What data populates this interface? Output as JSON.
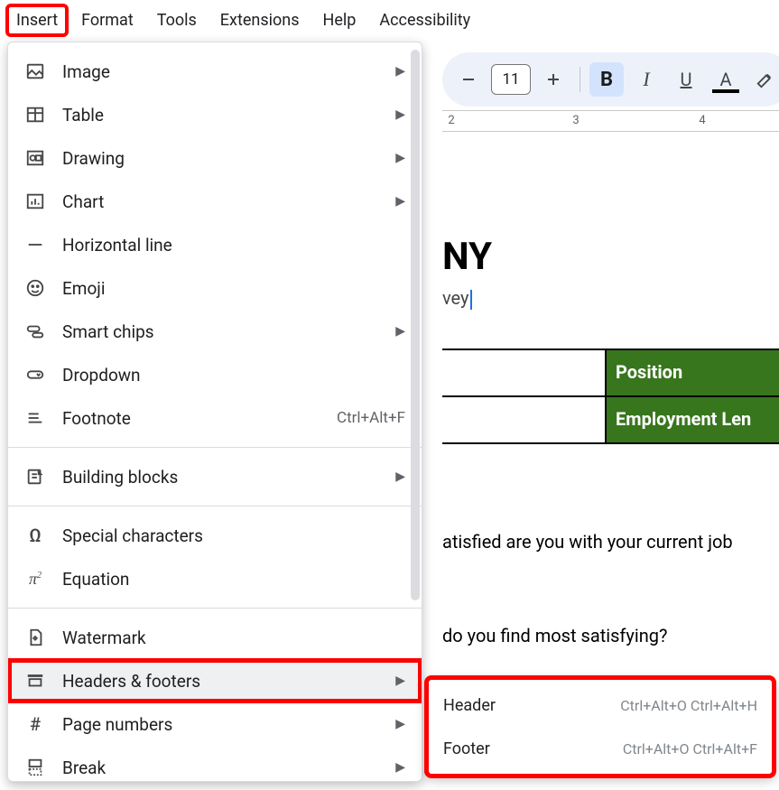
{
  "menubar": {
    "insert": "Insert",
    "format": "Format",
    "tools": "Tools",
    "extensions": "Extensions",
    "help": "Help",
    "accessibility": "Accessibility"
  },
  "toolbar": {
    "font_size": "11",
    "bold_glyph": "B",
    "italic_glyph": "I",
    "underline_glyph": "U",
    "textcolor_glyph": "A"
  },
  "ruler": {
    "n2": "2",
    "n3": "3",
    "n4": "4"
  },
  "doc": {
    "heading_fragment": "NY",
    "subtitle_fragment": "vey",
    "table": {
      "h1": "Position",
      "h2": "Employment Len"
    },
    "q1": "atisfied are you with your current job",
    "q2": "do you find most satisfying?"
  },
  "insert_menu": {
    "image": "Image",
    "table": "Table",
    "drawing": "Drawing",
    "chart": "Chart",
    "hr": "Horizontal line",
    "emoji": "Emoji",
    "smartchips": "Smart chips",
    "dropdown": "Dropdown",
    "footnote": "Footnote",
    "footnote_sc": "Ctrl+Alt+F",
    "buildingblocks": "Building blocks",
    "specialchars": "Special characters",
    "equation": "Equation",
    "watermark": "Watermark",
    "headersfooters": "Headers & footers",
    "pagenumbers": "Page numbers",
    "break": "Break"
  },
  "hf_submenu": {
    "header": "Header",
    "header_sc": "Ctrl+Alt+O Ctrl+Alt+H",
    "footer": "Footer",
    "footer_sc": "Ctrl+Alt+O Ctrl+Alt+F"
  }
}
